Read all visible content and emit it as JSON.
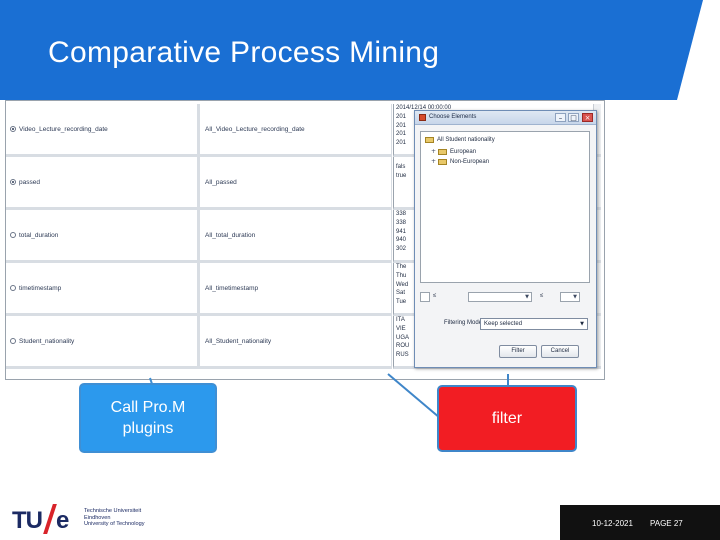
{
  "slide": {
    "title": "Comparative Process Mining",
    "accent_color": "#1a6fd3"
  },
  "grid": {
    "rows": [
      {
        "left": "Video_Lecture_recording_date",
        "right": "All_Video_Lecture_recording_date",
        "selected": true
      },
      {
        "left": "passed",
        "right": "All_passed",
        "selected": true
      },
      {
        "left": "total_duration",
        "right": "All_total_duration",
        "selected": false
      },
      {
        "left": "timetimestamp",
        "right": "All_timetimestamp",
        "selected": false
      },
      {
        "left": "Student_nationality",
        "right": "All_Student_nationality",
        "selected": false
      }
    ],
    "value_lists": [
      [
        "2014/12/14 00:00:00",
        "201",
        "201",
        "201",
        "201"
      ],
      [
        "fals",
        "true"
      ],
      [
        "338",
        "338",
        "941",
        "940",
        "302"
      ],
      [
        "The",
        "Thu",
        "Wed",
        "Sat",
        "Tue"
      ],
      [
        "ITA",
        "VIE",
        "UGA",
        "ROU",
        "RUS"
      ]
    ]
  },
  "dialog": {
    "title": "Choose Elements",
    "tree_root": "All Student nationality",
    "tree_children": [
      "European",
      "Non-European"
    ],
    "range_prefix": "≤",
    "range_suffix": "≤",
    "filtering_mode_label": "Filtering Mode",
    "filtering_mode_value": "Keep selected",
    "filter_button": "Filter",
    "cancel_button": "Cancel",
    "minimize_glyph": "–",
    "maximize_glyph": "□",
    "close_glyph": "×"
  },
  "callouts": {
    "prom_label_1": "Call Pro.M",
    "prom_label_2": "plugins",
    "filter_label": "filter",
    "blue_color": "#2c99ed",
    "red_color": "#f21d23"
  },
  "footer": {
    "logo_mark": "TU",
    "logo_e": "e",
    "logo_line1": "Technische Universiteit",
    "logo_line2": "Eindhoven",
    "logo_line3": "University of Technology",
    "date": "10-12-2021",
    "page": "PAGE 27"
  }
}
